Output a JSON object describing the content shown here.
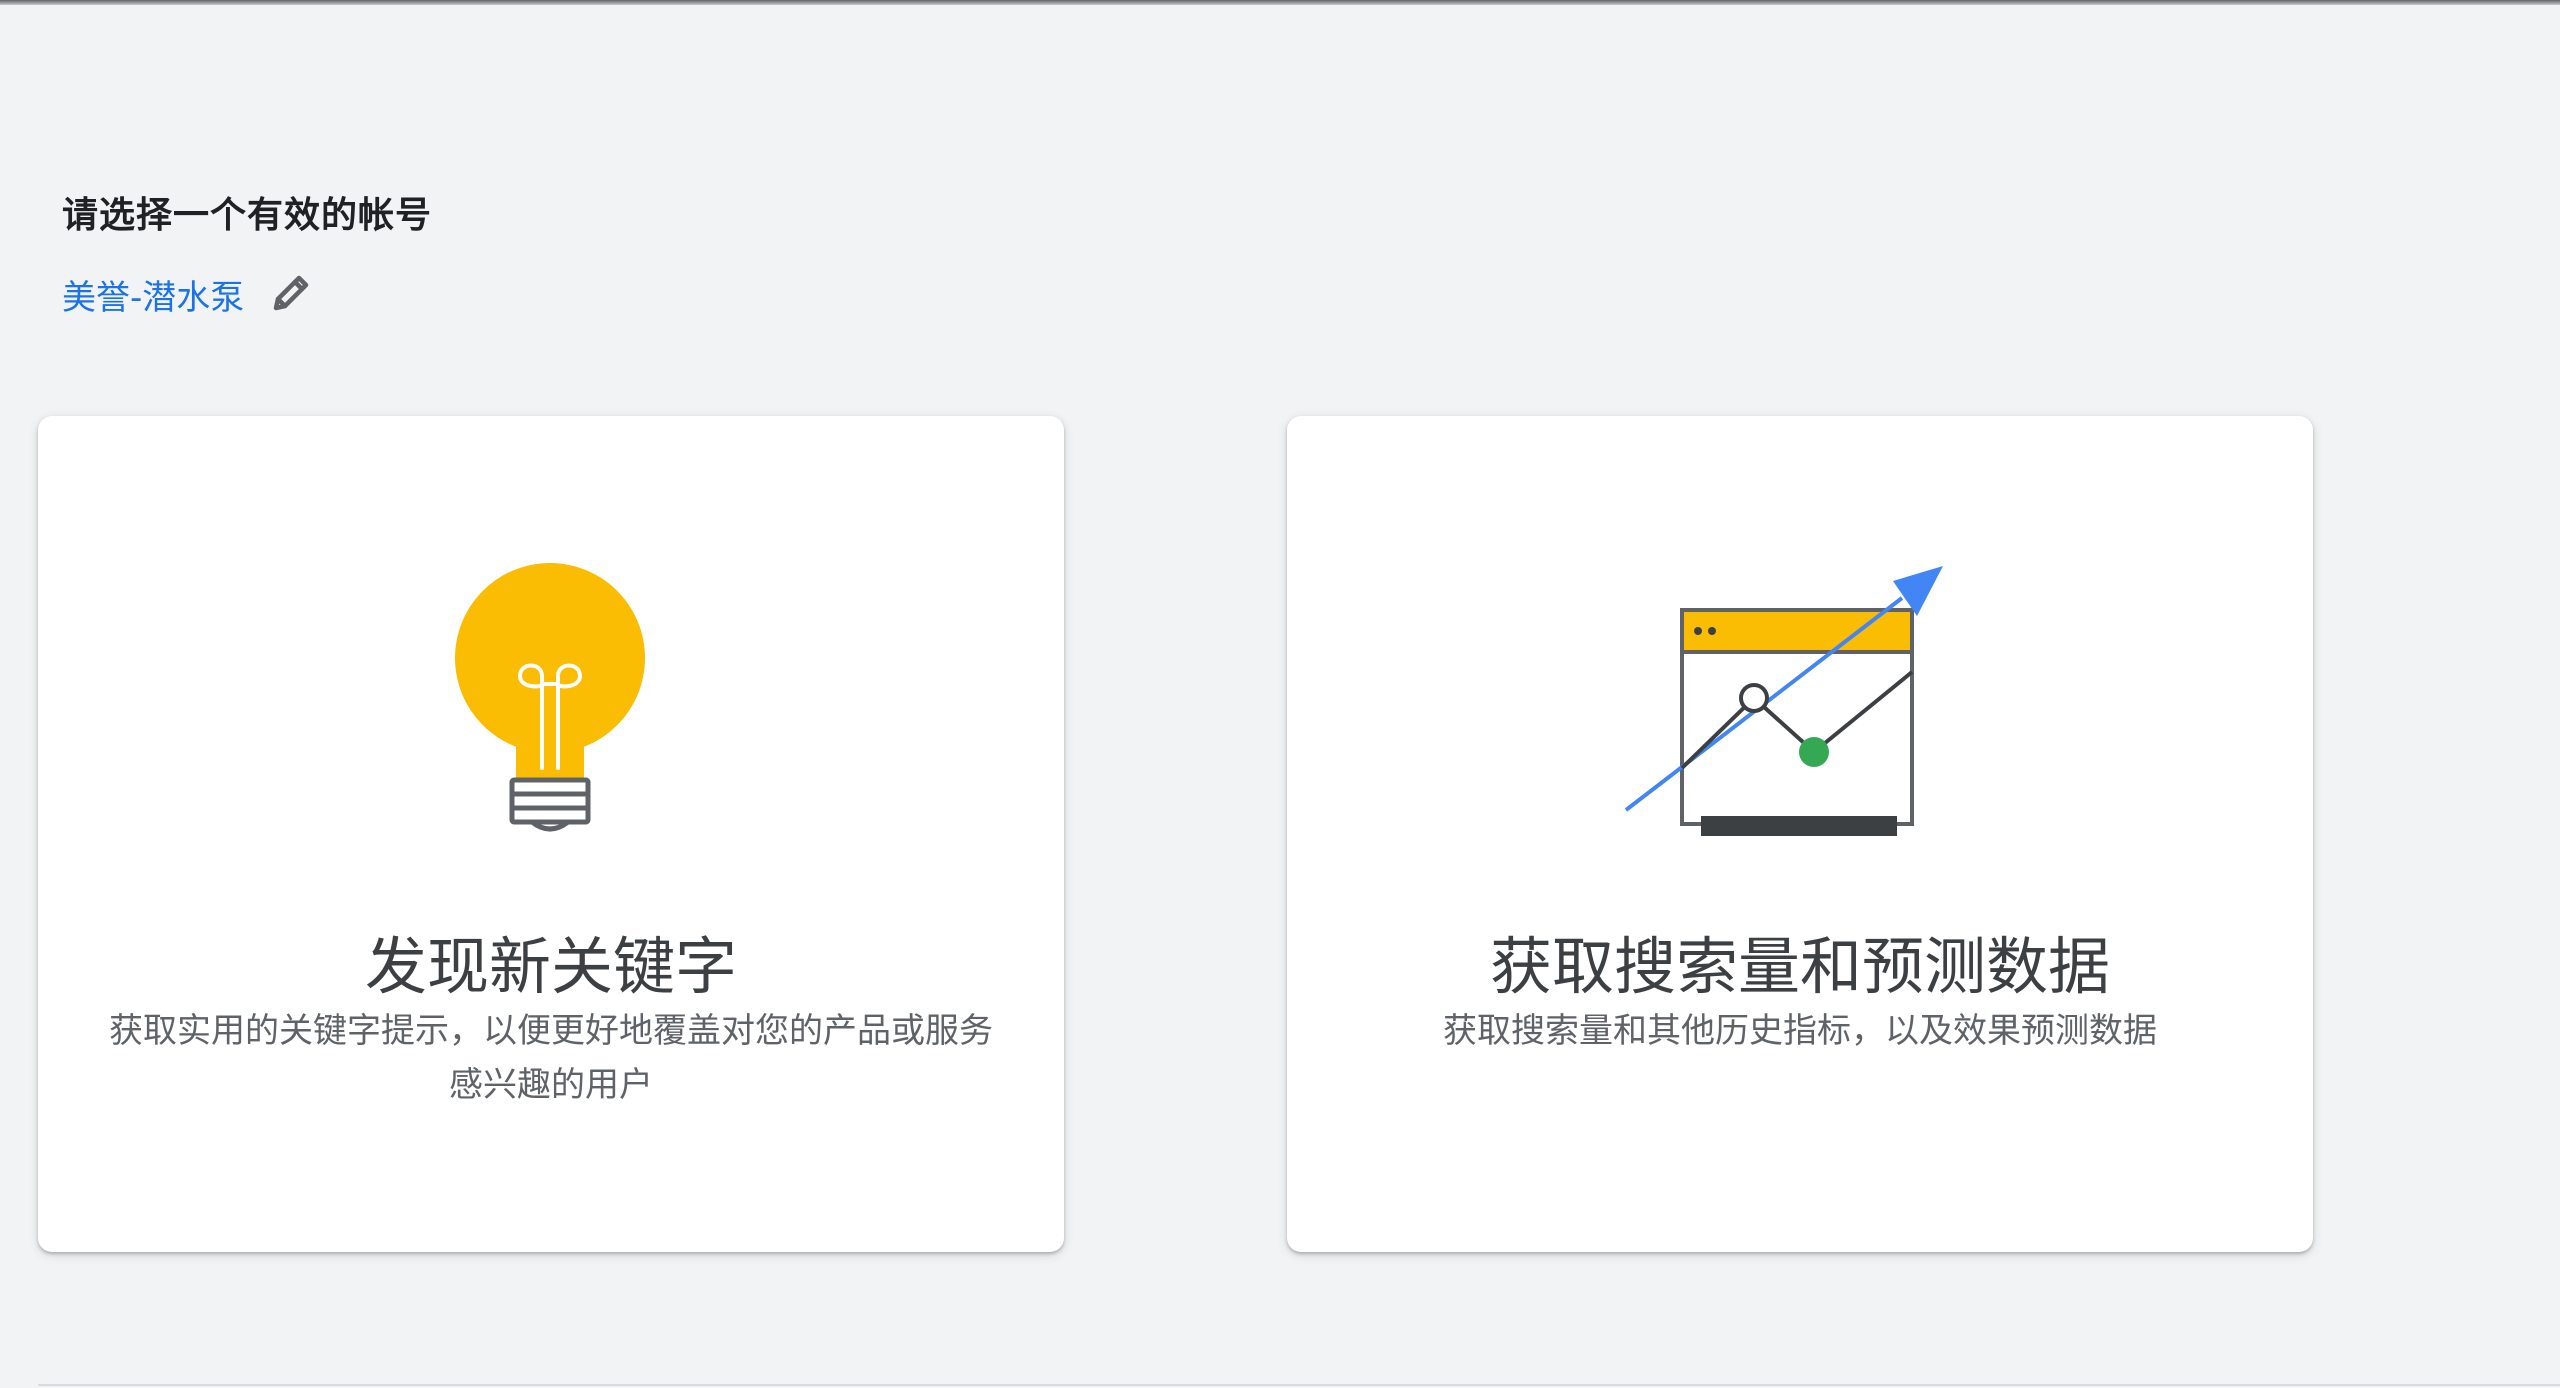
{
  "header": {
    "title": "请选择一个有效的帐号",
    "account_name": "美誉-潜水泵"
  },
  "icons": {
    "edit": "pencil-icon",
    "discover": "lightbulb-icon",
    "forecast": "trending-chart-icon"
  },
  "colors": {
    "accent": "#1a73e8",
    "bulb_yellow": "#fbbc04",
    "arrow_blue": "#4285f4",
    "point_green": "#34a853"
  },
  "cards": [
    {
      "title": "发现新关键字",
      "description": "获取实用的关键字提示，以便更好地覆盖对您的产品或服务感兴趣的用户"
    },
    {
      "title": "获取搜索量和预测数据",
      "description": "获取搜索量和其他历史指标，以及效果预测数据"
    }
  ]
}
